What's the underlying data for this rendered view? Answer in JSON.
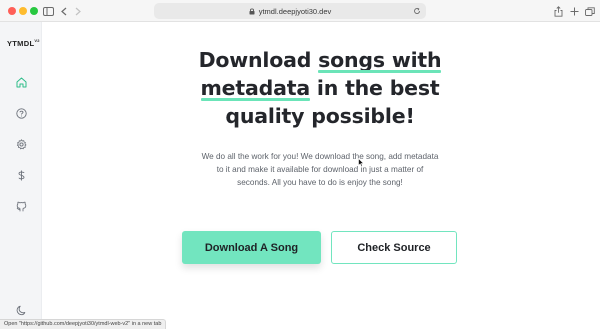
{
  "browser": {
    "url": "ytmdl.deepjyoti30.dev",
    "status_text": "Open \"https://github.com/deepjyoti30/ytmdl-web-v2\" in a new tab"
  },
  "sidebar": {
    "logo": "YTMDL",
    "logo_version": "V2",
    "items": [
      {
        "name": "home",
        "icon": "home-icon"
      },
      {
        "name": "help",
        "icon": "question-circle-icon"
      },
      {
        "name": "settings",
        "icon": "gear-icon"
      },
      {
        "name": "donate",
        "icon": "dollar-icon"
      },
      {
        "name": "github",
        "icon": "github-icon"
      }
    ],
    "theme_toggle_icon": "moon-icon"
  },
  "main": {
    "headline": {
      "part1": "Download ",
      "highlight1": "songs with",
      "highlight2": "metadata",
      "part2": " in the best",
      "part3": "quality possible!"
    },
    "subtext": "We do all the work for you! We download the song, add metadata to it and make it available for download in just a matter of seconds. All you have to do is enjoy the song!",
    "primary_button": "Download A Song",
    "secondary_button": "Check Source"
  },
  "colors": {
    "accent": "#72e5bf",
    "text_dark": "#24262b",
    "sidebar_bg": "#f4f5f7"
  }
}
